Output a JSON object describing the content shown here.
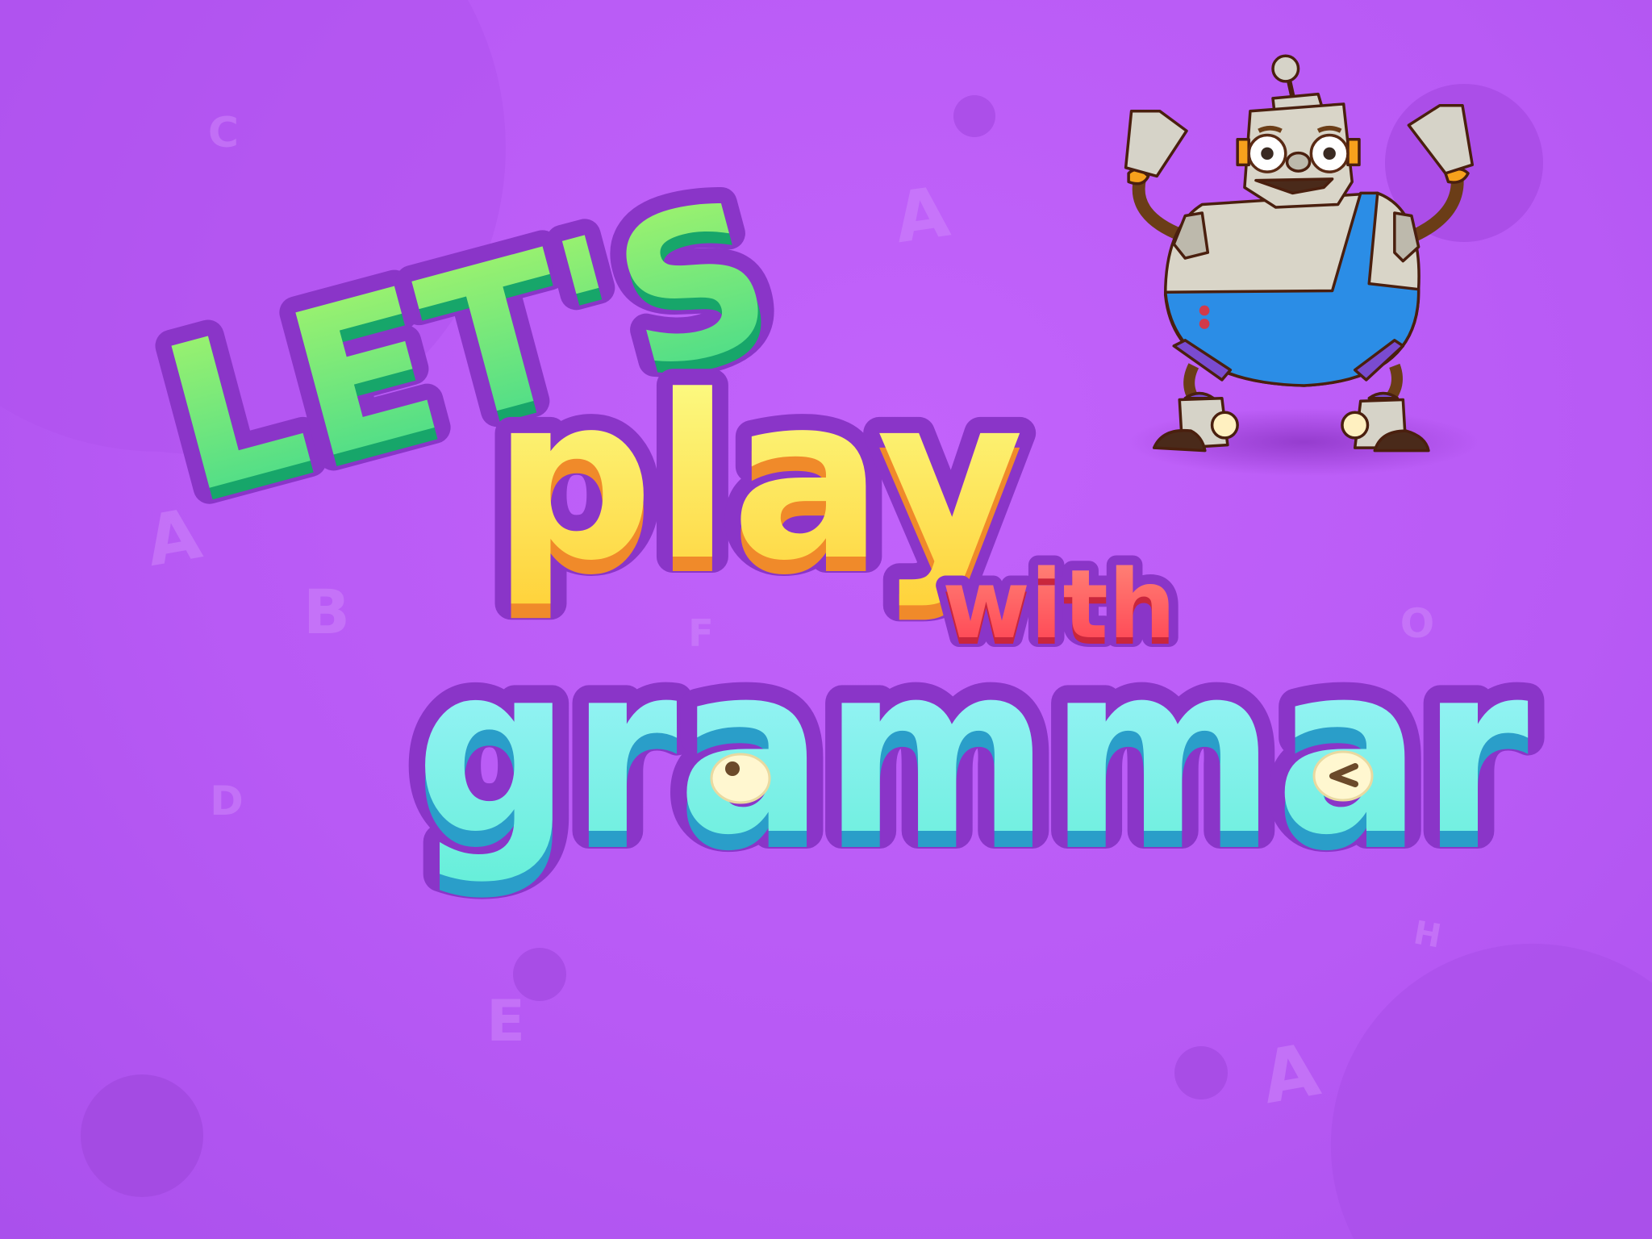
{
  "title": {
    "line1": "LET'S",
    "line2": "play",
    "line3": "with",
    "line4": "grammar"
  },
  "background_letters": [
    "C",
    "A",
    "A",
    "B",
    "F",
    "D",
    "O",
    "H",
    "E",
    "A"
  ],
  "colors": {
    "background": "#b85af5",
    "lets_green": "#5ee88a",
    "play_yellow": "#ffe94f",
    "with_red": "#ff5b5b",
    "grammar_cyan": "#7ff0e8",
    "outline_purple": "#8a35c8",
    "robot_blue": "#2b8de6"
  },
  "mascot": "robot"
}
